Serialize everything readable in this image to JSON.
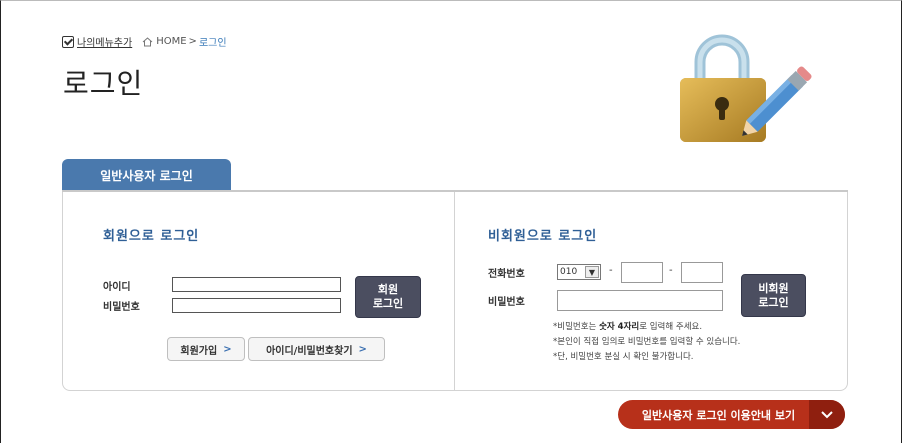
{
  "breadcrumb": {
    "add_menu": "나의메뉴추가",
    "home": "HOME",
    "separator": ">",
    "current": "로그인"
  },
  "page_title": "로그인",
  "tabs": [
    {
      "label": "일반사용자 로그인",
      "active": true
    }
  ],
  "member": {
    "heading": "회원으로 로그인",
    "id_label": "아이디",
    "id_value": "",
    "pw_label": "비밀번호",
    "pw_value": "",
    "login_button": "회원\n로그인",
    "join_button": "회원가입",
    "find_button": "아이디/비밀번호찾기",
    "arrow": ">"
  },
  "nonmember": {
    "heading": "비회원으로 로그인",
    "phone_label": "전화번호",
    "phone_prefix": "010",
    "phone_mid": "",
    "phone_last": "",
    "dash": "-",
    "pw_label": "비밀번호",
    "pw_value": "",
    "login_button": "비회원\n로그인",
    "notes": [
      {
        "prefix": "*비밀번호는 ",
        "bold": "숫자 4자리",
        "suffix": "로 입력해 주세요."
      },
      {
        "prefix": "*본인이 직접 임의로 비밀번호를 입력할 수 있습니다.",
        "bold": "",
        "suffix": ""
      },
      {
        "prefix": "*단, 비밀번호 분실 시 확인 불가합니다.",
        "bold": "",
        "suffix": ""
      }
    ]
  },
  "guide_button": "일반사용자 로그인 이용안내 보기",
  "colors": {
    "tab_blue": "#4a79ad",
    "heading_blue": "#2f5f96",
    "dark_button": "#4b4e60",
    "guide_red": "#b7301a"
  },
  "icons": [
    "checkbox-icon",
    "home-icon",
    "lock-pencil-illustration",
    "chevron-down-icon",
    "chevron-right-icon"
  ]
}
